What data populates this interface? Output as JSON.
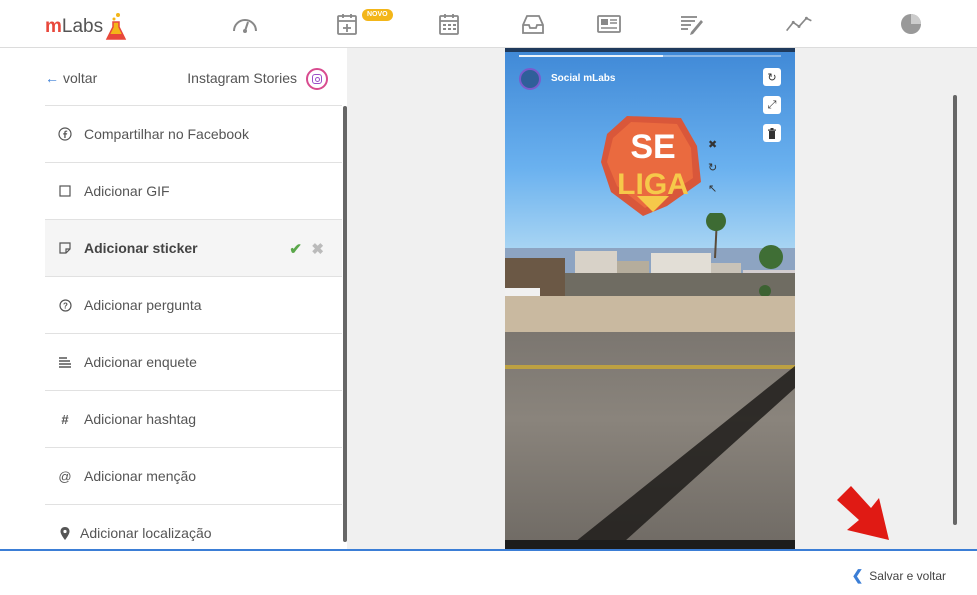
{
  "brand": {
    "logo_m": "m",
    "logo_labs": "Labs",
    "accent": "#e8473b",
    "primary": "#3b7ed6"
  },
  "topnav": {
    "items": [
      {
        "icon": "dashboard-gauge-icon"
      },
      {
        "icon": "calendar-add-icon",
        "badge": "NOVO"
      },
      {
        "icon": "calendar-icon"
      },
      {
        "icon": "inbox-icon"
      },
      {
        "icon": "newspaper-icon"
      },
      {
        "icon": "edit-list-icon"
      },
      {
        "icon": "analytics-line-icon"
      },
      {
        "icon": "pie-chart-icon"
      }
    ]
  },
  "left": {
    "back_label": "voltar",
    "title": "Instagram Stories",
    "items": [
      {
        "icon": "facebook-icon",
        "label": "Compartilhar no Facebook"
      },
      {
        "icon": "gif-icon",
        "label": "Adicionar GIF"
      },
      {
        "icon": "sticker-icon",
        "label": "Adicionar sticker",
        "active": true
      },
      {
        "icon": "question-icon",
        "label": "Adicionar pergunta"
      },
      {
        "icon": "poll-icon",
        "label": "Adicionar enquete"
      },
      {
        "icon": "hashtag-icon",
        "label": "Adicionar hashtag"
      },
      {
        "icon": "mention-icon",
        "label": "Adicionar menção"
      },
      {
        "icon": "location-pin-icon",
        "label": "Adicionar localização"
      }
    ]
  },
  "preview": {
    "profile_name": "Social mLabs",
    "sticker_text_1": "SE",
    "sticker_text_2": "LIGA"
  },
  "footer": {
    "save_back_label": "Salvar e voltar"
  }
}
